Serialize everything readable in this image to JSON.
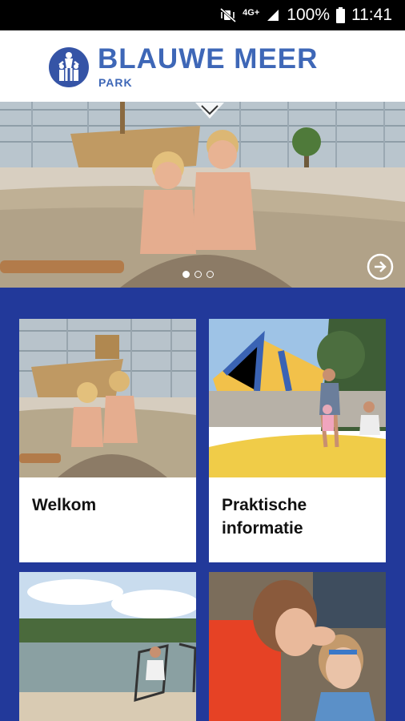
{
  "status_bar": {
    "network": "4G+",
    "battery": "100%",
    "time": "11:41",
    "icons": [
      "mute-vibrate-icon",
      "signal-icon",
      "battery-icon"
    ]
  },
  "header": {
    "brand": "BLAUWE MEER",
    "brand_sub": "PARK"
  },
  "hero": {
    "slides": 3,
    "active_slide": 1
  },
  "tiles": [
    {
      "label": "Welkom"
    },
    {
      "label": "Praktische informatie"
    },
    {
      "label": ""
    },
    {
      "label": ""
    }
  ],
  "colors": {
    "background": "#22399a",
    "brand": "#3e67b7",
    "logo": "#3554a6"
  }
}
